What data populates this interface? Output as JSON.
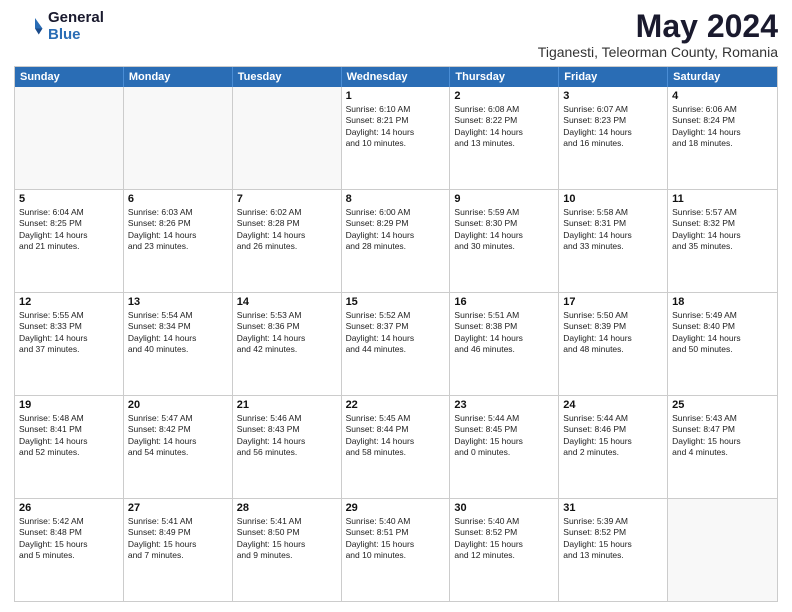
{
  "header": {
    "logo_general": "General",
    "logo_blue": "Blue",
    "month_title": "May 2024",
    "subtitle": "Tiganesti, Teleorman County, Romania"
  },
  "weekdays": [
    "Sunday",
    "Monday",
    "Tuesday",
    "Wednesday",
    "Thursday",
    "Friday",
    "Saturday"
  ],
  "rows": [
    [
      {
        "day": "",
        "text": ""
      },
      {
        "day": "",
        "text": ""
      },
      {
        "day": "",
        "text": ""
      },
      {
        "day": "1",
        "text": "Sunrise: 6:10 AM\nSunset: 8:21 PM\nDaylight: 14 hours\nand 10 minutes."
      },
      {
        "day": "2",
        "text": "Sunrise: 6:08 AM\nSunset: 8:22 PM\nDaylight: 14 hours\nand 13 minutes."
      },
      {
        "day": "3",
        "text": "Sunrise: 6:07 AM\nSunset: 8:23 PM\nDaylight: 14 hours\nand 16 minutes."
      },
      {
        "day": "4",
        "text": "Sunrise: 6:06 AM\nSunset: 8:24 PM\nDaylight: 14 hours\nand 18 minutes."
      }
    ],
    [
      {
        "day": "5",
        "text": "Sunrise: 6:04 AM\nSunset: 8:25 PM\nDaylight: 14 hours\nand 21 minutes."
      },
      {
        "day": "6",
        "text": "Sunrise: 6:03 AM\nSunset: 8:26 PM\nDaylight: 14 hours\nand 23 minutes."
      },
      {
        "day": "7",
        "text": "Sunrise: 6:02 AM\nSunset: 8:28 PM\nDaylight: 14 hours\nand 26 minutes."
      },
      {
        "day": "8",
        "text": "Sunrise: 6:00 AM\nSunset: 8:29 PM\nDaylight: 14 hours\nand 28 minutes."
      },
      {
        "day": "9",
        "text": "Sunrise: 5:59 AM\nSunset: 8:30 PM\nDaylight: 14 hours\nand 30 minutes."
      },
      {
        "day": "10",
        "text": "Sunrise: 5:58 AM\nSunset: 8:31 PM\nDaylight: 14 hours\nand 33 minutes."
      },
      {
        "day": "11",
        "text": "Sunrise: 5:57 AM\nSunset: 8:32 PM\nDaylight: 14 hours\nand 35 minutes."
      }
    ],
    [
      {
        "day": "12",
        "text": "Sunrise: 5:55 AM\nSunset: 8:33 PM\nDaylight: 14 hours\nand 37 minutes."
      },
      {
        "day": "13",
        "text": "Sunrise: 5:54 AM\nSunset: 8:34 PM\nDaylight: 14 hours\nand 40 minutes."
      },
      {
        "day": "14",
        "text": "Sunrise: 5:53 AM\nSunset: 8:36 PM\nDaylight: 14 hours\nand 42 minutes."
      },
      {
        "day": "15",
        "text": "Sunrise: 5:52 AM\nSunset: 8:37 PM\nDaylight: 14 hours\nand 44 minutes."
      },
      {
        "day": "16",
        "text": "Sunrise: 5:51 AM\nSunset: 8:38 PM\nDaylight: 14 hours\nand 46 minutes."
      },
      {
        "day": "17",
        "text": "Sunrise: 5:50 AM\nSunset: 8:39 PM\nDaylight: 14 hours\nand 48 minutes."
      },
      {
        "day": "18",
        "text": "Sunrise: 5:49 AM\nSunset: 8:40 PM\nDaylight: 14 hours\nand 50 minutes."
      }
    ],
    [
      {
        "day": "19",
        "text": "Sunrise: 5:48 AM\nSunset: 8:41 PM\nDaylight: 14 hours\nand 52 minutes."
      },
      {
        "day": "20",
        "text": "Sunrise: 5:47 AM\nSunset: 8:42 PM\nDaylight: 14 hours\nand 54 minutes."
      },
      {
        "day": "21",
        "text": "Sunrise: 5:46 AM\nSunset: 8:43 PM\nDaylight: 14 hours\nand 56 minutes."
      },
      {
        "day": "22",
        "text": "Sunrise: 5:45 AM\nSunset: 8:44 PM\nDaylight: 14 hours\nand 58 minutes."
      },
      {
        "day": "23",
        "text": "Sunrise: 5:44 AM\nSunset: 8:45 PM\nDaylight: 15 hours\nand 0 minutes."
      },
      {
        "day": "24",
        "text": "Sunrise: 5:44 AM\nSunset: 8:46 PM\nDaylight: 15 hours\nand 2 minutes."
      },
      {
        "day": "25",
        "text": "Sunrise: 5:43 AM\nSunset: 8:47 PM\nDaylight: 15 hours\nand 4 minutes."
      }
    ],
    [
      {
        "day": "26",
        "text": "Sunrise: 5:42 AM\nSunset: 8:48 PM\nDaylight: 15 hours\nand 5 minutes."
      },
      {
        "day": "27",
        "text": "Sunrise: 5:41 AM\nSunset: 8:49 PM\nDaylight: 15 hours\nand 7 minutes."
      },
      {
        "day": "28",
        "text": "Sunrise: 5:41 AM\nSunset: 8:50 PM\nDaylight: 15 hours\nand 9 minutes."
      },
      {
        "day": "29",
        "text": "Sunrise: 5:40 AM\nSunset: 8:51 PM\nDaylight: 15 hours\nand 10 minutes."
      },
      {
        "day": "30",
        "text": "Sunrise: 5:40 AM\nSunset: 8:52 PM\nDaylight: 15 hours\nand 12 minutes."
      },
      {
        "day": "31",
        "text": "Sunrise: 5:39 AM\nSunset: 8:52 PM\nDaylight: 15 hours\nand 13 minutes."
      },
      {
        "day": "",
        "text": ""
      }
    ]
  ]
}
